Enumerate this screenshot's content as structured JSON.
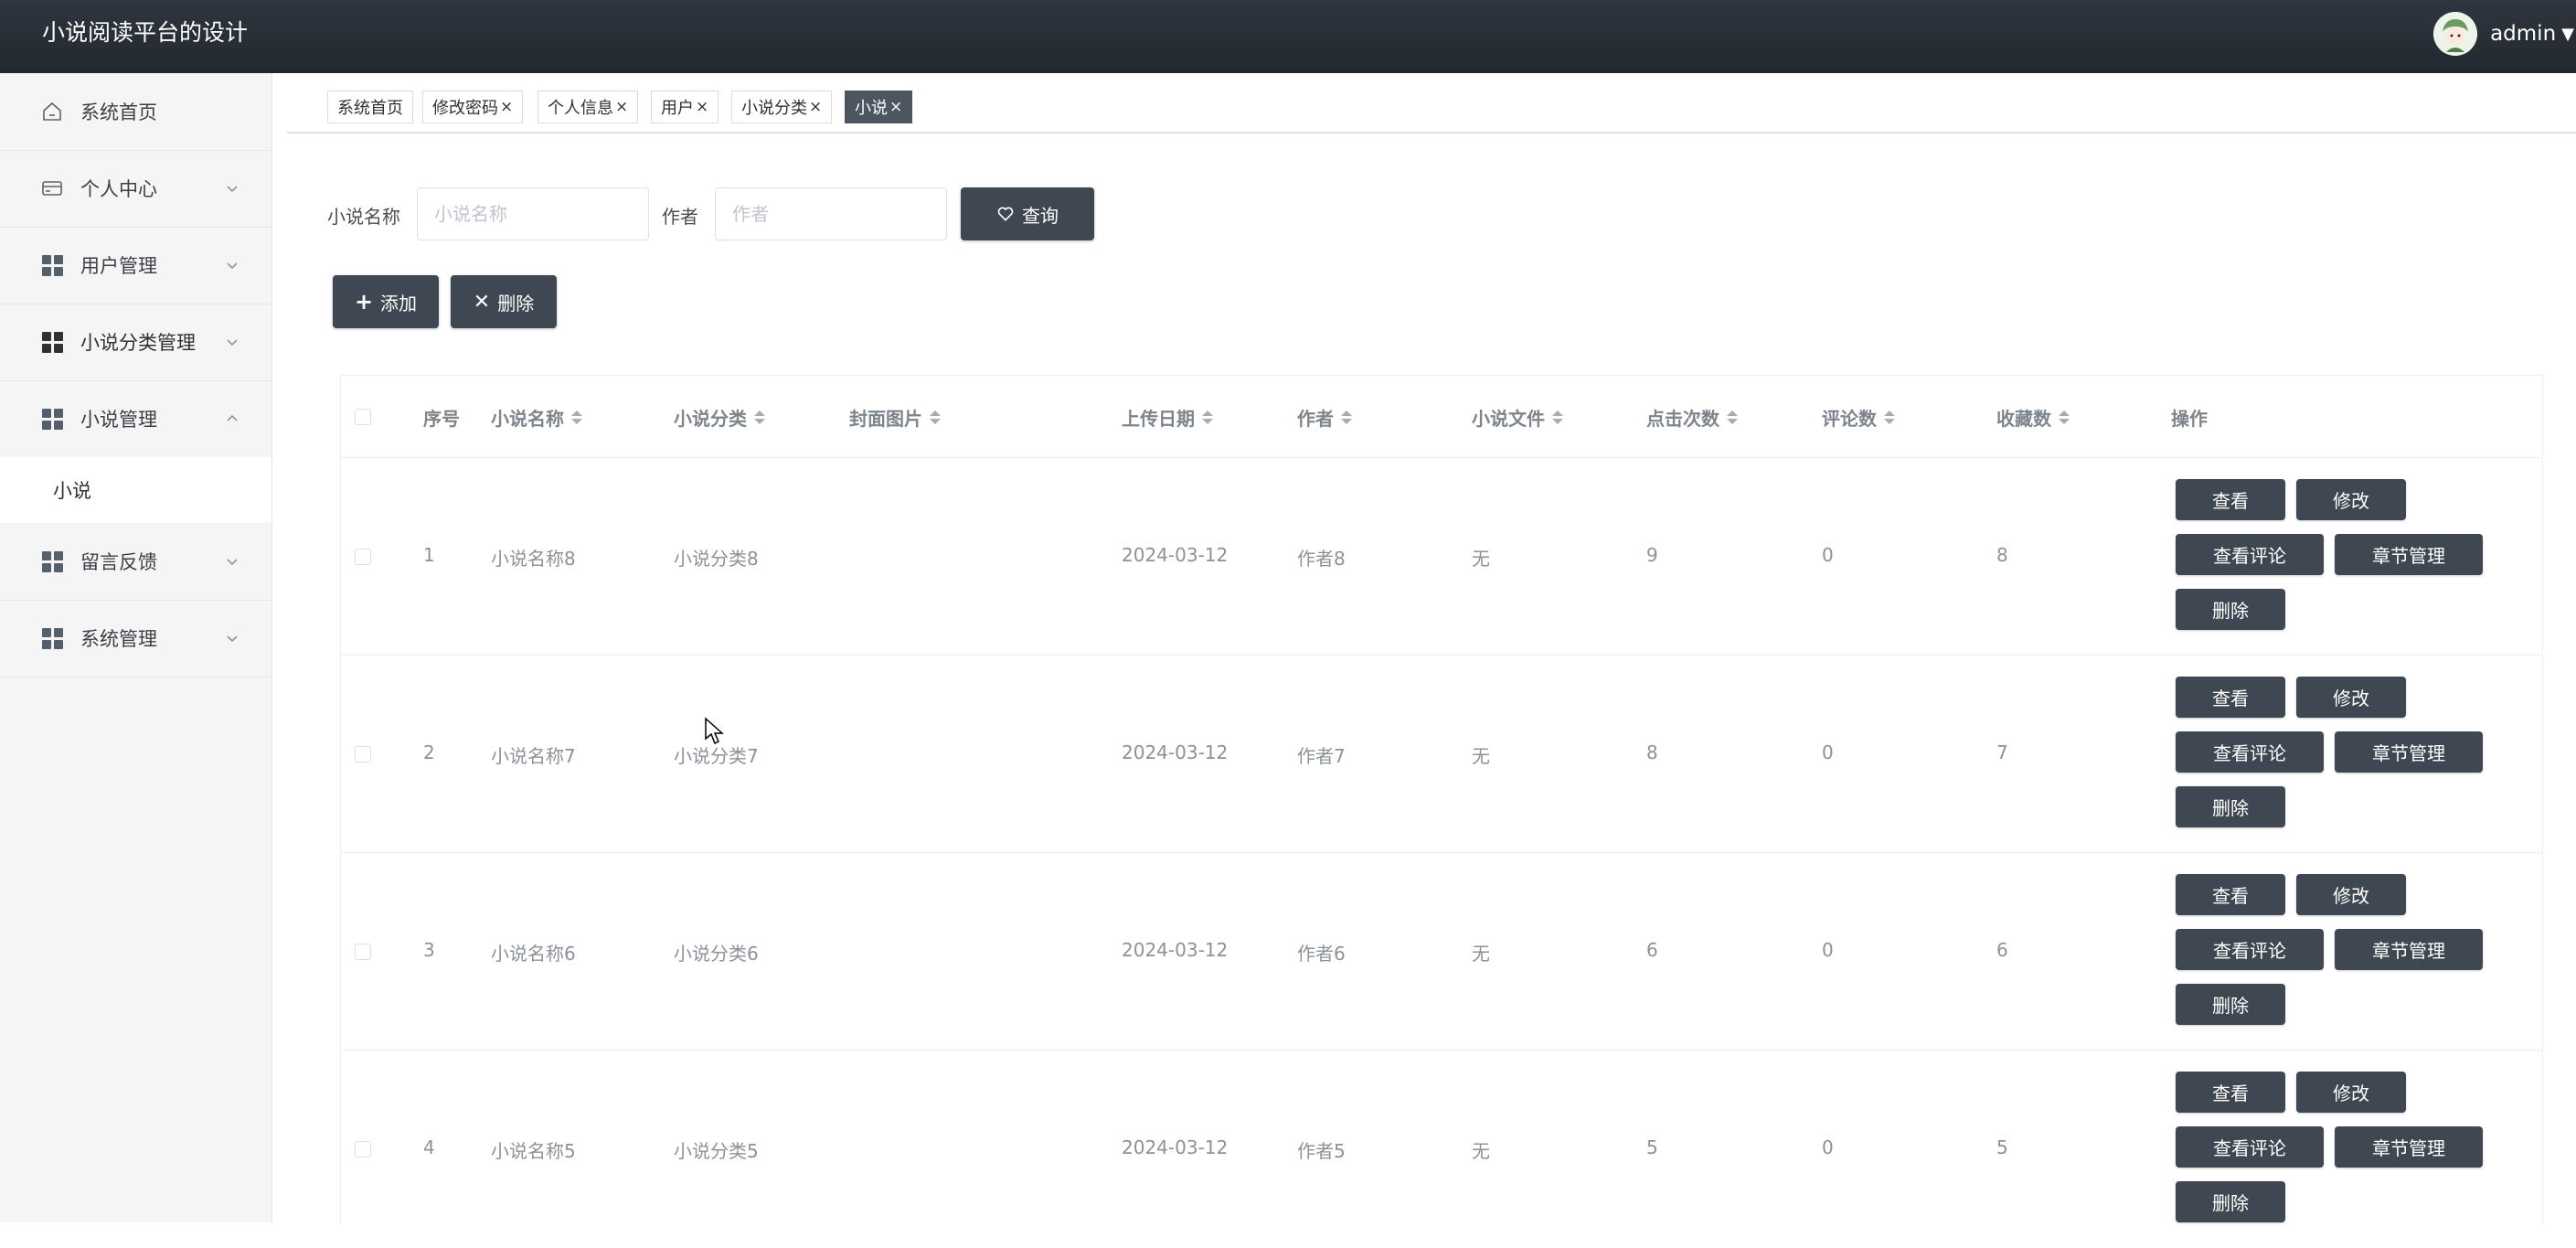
{
  "header": {
    "title": "小说阅读平台的设计",
    "user": "admin"
  },
  "sidebar": {
    "items": [
      {
        "label": "系统首页"
      },
      {
        "label": "个人中心"
      },
      {
        "label": "用户管理"
      },
      {
        "label": "小说分类管理"
      },
      {
        "label": "小说管理"
      },
      {
        "label": "留言反馈"
      },
      {
        "label": "系统管理"
      }
    ],
    "sub_items": [
      {
        "label": "小说"
      }
    ]
  },
  "tabs": [
    {
      "label": "系统首页",
      "close": ""
    },
    {
      "label": "修改密码",
      "close": "×"
    },
    {
      "label": "个人信息",
      "close": "×"
    },
    {
      "label": "用户",
      "close": "×"
    },
    {
      "label": "小说分类",
      "close": "×"
    },
    {
      "label": "小说",
      "close": "×"
    }
  ],
  "search": {
    "name_label": "小说名称",
    "name_placeholder": "小说名称",
    "author_label": "作者",
    "author_placeholder": "作者",
    "query_button": "查询"
  },
  "actions": {
    "add": "添加",
    "delete": "删除"
  },
  "table": {
    "headers": [
      "序号",
      "小说名称",
      "小说分类",
      "封面图片",
      "上传日期",
      "作者",
      "小说文件",
      "点击次数",
      "评论数",
      "收藏数",
      "操作"
    ],
    "rows": [
      {
        "index": "1",
        "name": "小说名称8",
        "category": "小说分类8",
        "date": "2024-03-12",
        "author": "作者8",
        "file": "无",
        "clicks": "9",
        "comments": "0",
        "favorites": "8"
      },
      {
        "index": "2",
        "name": "小说名称7",
        "category": "小说分类7",
        "date": "2024-03-12",
        "author": "作者7",
        "file": "无",
        "clicks": "8",
        "comments": "0",
        "favorites": "7"
      },
      {
        "index": "3",
        "name": "小说名称6",
        "category": "小说分类6",
        "date": "2024-03-12",
        "author": "作者6",
        "file": "无",
        "clicks": "6",
        "comments": "0",
        "favorites": "6"
      },
      {
        "index": "4",
        "name": "小说名称5",
        "category": "小说分类5",
        "date": "2024-03-12",
        "author": "作者5",
        "file": "无",
        "clicks": "5",
        "comments": "0",
        "favorites": "5"
      }
    ],
    "row_actions": {
      "view": "查看",
      "edit": "修改",
      "view_comments": "查看评论",
      "chapters": "章节管理",
      "delete": "删除"
    }
  },
  "colors": {
    "header_bg": "#2b323a",
    "button_bg": "#3f4852",
    "sidebar_bg": "#f5f5f5"
  }
}
